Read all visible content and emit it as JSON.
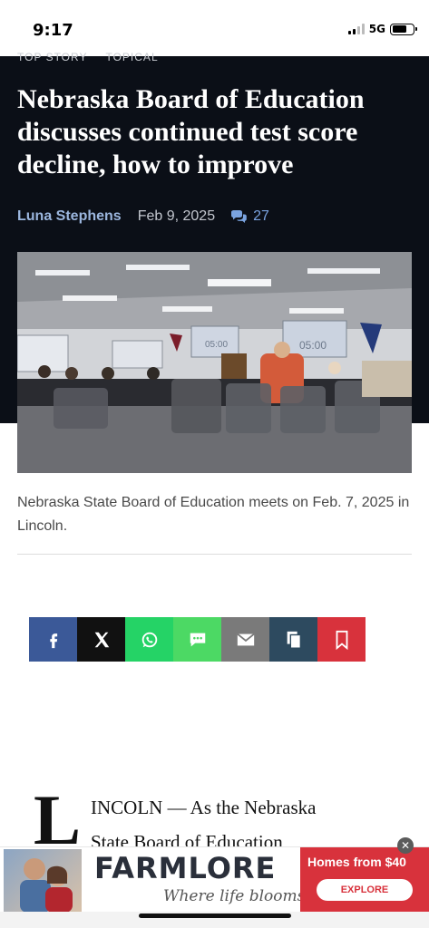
{
  "status_bar": {
    "time": "9:17",
    "network": "5G"
  },
  "article": {
    "kicker_items": [
      "TOP STORY",
      "TOPICAL"
    ],
    "headline": "Nebraska Board of Education discusses continued test score decline, how to improve",
    "author": "Luna Stephens",
    "date": "Feb 9, 2025",
    "comment_count": "27",
    "photo_clock_text": "05:00",
    "caption": "Nebraska State Board of Education meets on Feb. 7, 2025 in Lincoln.",
    "dropcap": "L",
    "body_line1": "INCOLN — As the Nebraska",
    "body_line2": "State Board of Education"
  },
  "share_buttons": [
    {
      "name": "facebook",
      "icon": "facebook-icon",
      "color": "#3b5998"
    },
    {
      "name": "x",
      "icon": "x-icon",
      "color": "#111111"
    },
    {
      "name": "whatsapp",
      "icon": "whatsapp-icon",
      "color": "#25d366"
    },
    {
      "name": "sms",
      "icon": "sms-icon",
      "color": "#4cd964"
    },
    {
      "name": "email",
      "icon": "email-icon",
      "color": "#7a7a7a"
    },
    {
      "name": "copy",
      "icon": "copy-icon",
      "color": "#2d4a5f"
    },
    {
      "name": "bookmark",
      "icon": "bookmark-icon",
      "color": "#d8323c"
    }
  ],
  "ad": {
    "brand": "FARMLORE",
    "tagline": "Where life blooms",
    "headline": "Homes from $40",
    "cta": "EXPLORE"
  },
  "colors": {
    "hero_bg": "#0b0f17",
    "author": "#9bb6de",
    "accent_red": "#d8323c"
  }
}
